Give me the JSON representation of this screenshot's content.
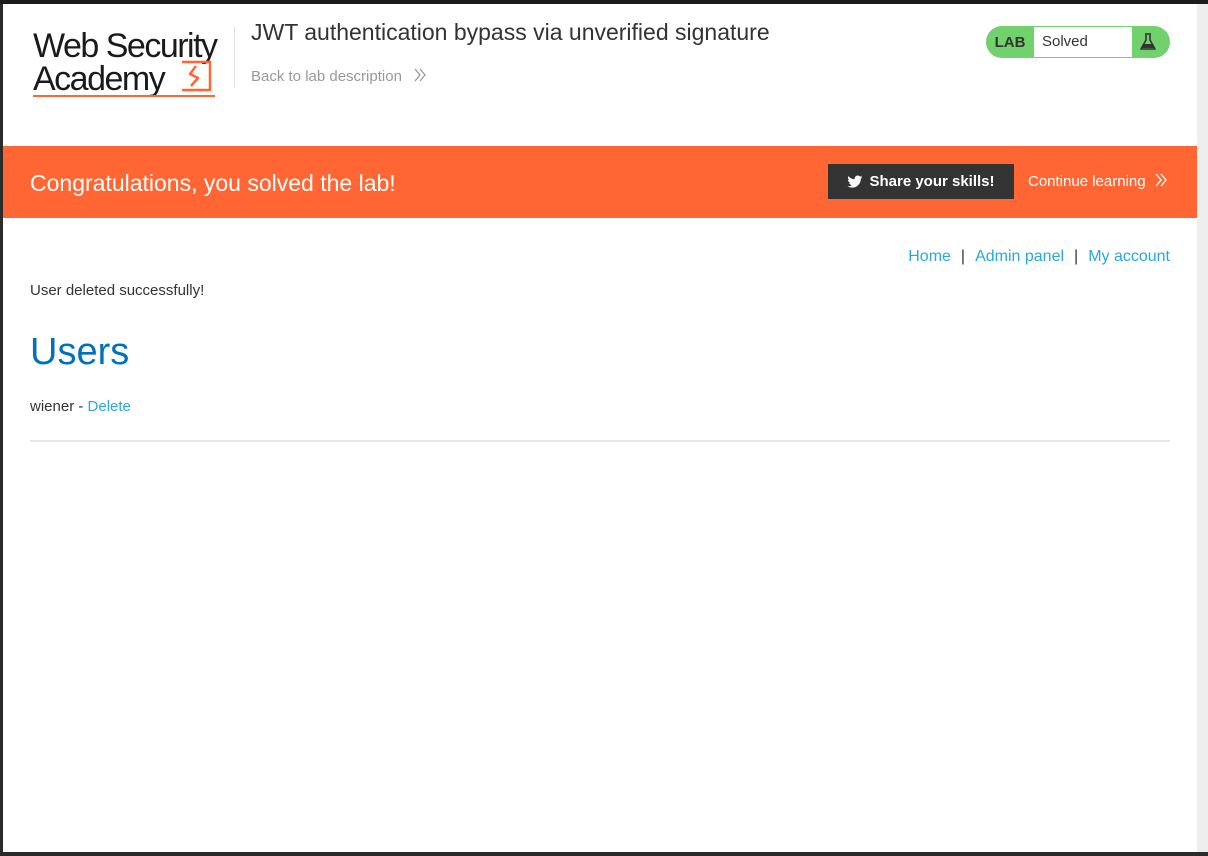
{
  "header": {
    "logo_line1": "Web Security",
    "logo_line2": "Academy",
    "lab_title": "JWT authentication bypass via unverified signature",
    "back_link": "Back to lab description",
    "lab_tag": "LAB",
    "lab_state": "Solved",
    "accent_color": "#ff6633",
    "status_color": "#70d16d"
  },
  "banner": {
    "message": "Congratulations, you solved the lab!",
    "share_label": "Share your skills!",
    "continue_label": "Continue learning"
  },
  "nav": {
    "home": "Home",
    "separator": "|",
    "admin_panel": "Admin panel",
    "my_account": "My account"
  },
  "main": {
    "status_message": "User deleted successfully!",
    "heading": "Users",
    "users": [
      {
        "name": "wiener",
        "separator": "-",
        "action": "Delete"
      }
    ]
  },
  "icons": [
    "logo-mark-icon",
    "chevron-double-right-icon",
    "flask-icon",
    "twitter-icon"
  ]
}
